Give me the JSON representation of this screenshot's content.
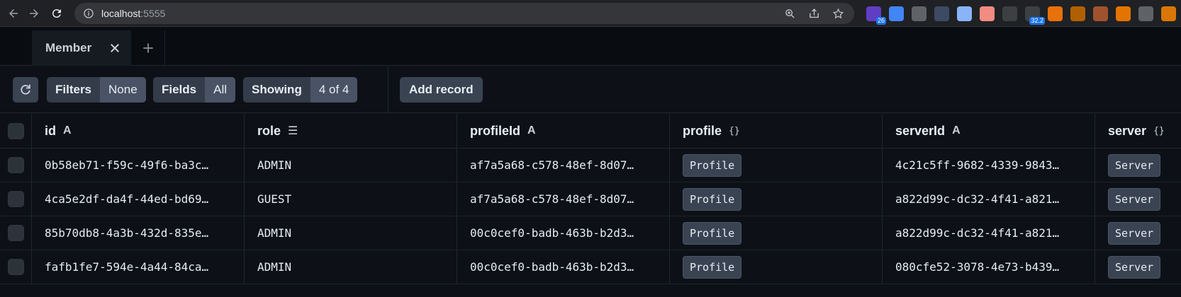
{
  "browser": {
    "url_host": "localhost",
    "url_port": ":5555",
    "extensions": [
      {
        "icon": "graduation-cap-icon",
        "color": "#5f3dc4",
        "badge": "26"
      },
      {
        "icon": "google-translate-icon",
        "color": "#4285f4",
        "badge": ""
      },
      {
        "icon": "target-icon",
        "color": "#5f6368",
        "badge": ""
      },
      {
        "icon": "circle-a-icon",
        "color": "#3c4a64",
        "badge": ""
      },
      {
        "icon": "magnifier-icon",
        "color": "#8ab4f8",
        "badge": ""
      },
      {
        "icon": "capsule-icon",
        "color": "#f28b82",
        "badge": ""
      },
      {
        "icon": "brackets-icon",
        "color": "#3c4043",
        "badge": ""
      },
      {
        "icon": "speed-icon",
        "color": "#3c4043",
        "badge": "32.2"
      },
      {
        "icon": "fox-icon",
        "color": "#e8710a",
        "badge": ""
      },
      {
        "icon": "cookie-icon",
        "color": "#b06000",
        "badge": ""
      },
      {
        "icon": "cookie-face-icon",
        "color": "#a0522d",
        "badge": ""
      },
      {
        "icon": "bars-icon",
        "color": "#e37400",
        "badge": ""
      },
      {
        "icon": "gear-icon",
        "color": "#5f6368",
        "badge": ""
      },
      {
        "icon": "avatar-icon",
        "color": "#d97706",
        "badge": ""
      }
    ]
  },
  "tabs": [
    {
      "label": "Member"
    }
  ],
  "toolbar": {
    "filters_label": "Filters",
    "filters_value": "None",
    "fields_label": "Fields",
    "fields_value": "All",
    "showing_label": "Showing",
    "showing_value": "4 of 4",
    "add_record_label": "Add record"
  },
  "columns": [
    {
      "name": "id",
      "type_icon": "A"
    },
    {
      "name": "role",
      "type_icon": "☰"
    },
    {
      "name": "profileId",
      "type_icon": "A"
    },
    {
      "name": "profile",
      "type_icon": "{}"
    },
    {
      "name": "serverId",
      "type_icon": "A"
    },
    {
      "name": "server",
      "type_icon": "{}"
    }
  ],
  "rows": [
    {
      "id": "0b58eb71-f59c-49f6-ba3c…",
      "role": "ADMIN",
      "profileId": "af7a5a68-c578-48ef-8d07…",
      "profile": "Profile",
      "serverId": "4c21c5ff-9682-4339-9843…",
      "server": "Server"
    },
    {
      "id": "4ca5e2df-da4f-44ed-bd69…",
      "role": "GUEST",
      "profileId": "af7a5a68-c578-48ef-8d07…",
      "profile": "Profile",
      "serverId": "a822d99c-dc32-4f41-a821…",
      "server": "Server"
    },
    {
      "id": "85b70db8-4a3b-432d-835e…",
      "role": "ADMIN",
      "profileId": "00c0cef0-badb-463b-b2d3…",
      "profile": "Profile",
      "serverId": "a822d99c-dc32-4f41-a821…",
      "server": "Server"
    },
    {
      "id": "fafb1fe7-594e-4a44-84ca…",
      "role": "ADMIN",
      "profileId": "00c0cef0-badb-463b-b2d3…",
      "profile": "Profile",
      "serverId": "080cfe52-3078-4e73-b439…",
      "server": "Server"
    }
  ]
}
